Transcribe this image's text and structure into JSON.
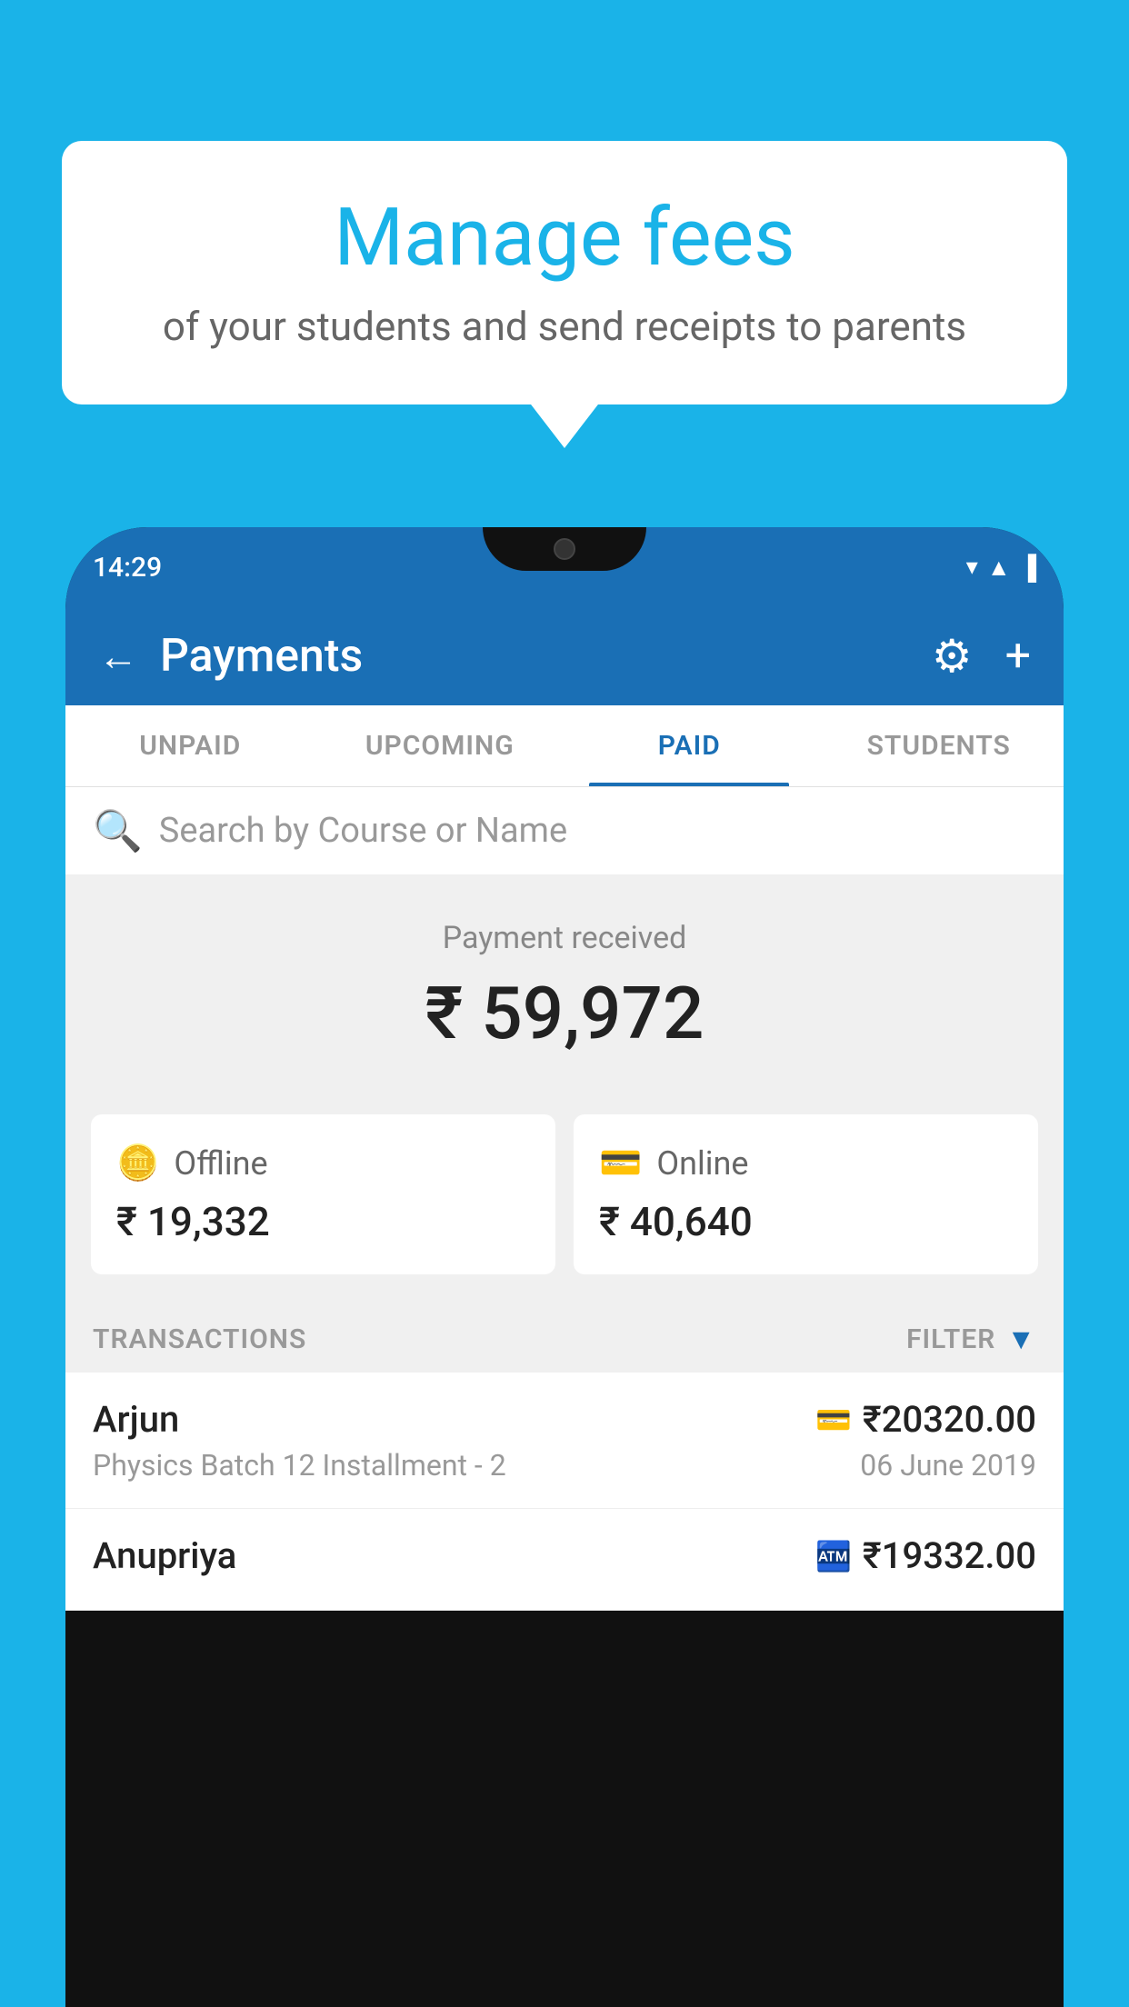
{
  "background_color": "#1ab3e8",
  "bubble": {
    "title": "Manage fees",
    "subtitle": "of your students and send receipts to parents"
  },
  "phone": {
    "status_bar": {
      "time": "14:29",
      "icons": [
        "▲",
        "◀",
        "▌"
      ]
    },
    "header": {
      "title": "Payments",
      "back_label": "←",
      "gear_label": "⚙",
      "plus_label": "+"
    },
    "tabs": [
      {
        "label": "UNPAID",
        "active": false
      },
      {
        "label": "UPCOMING",
        "active": false
      },
      {
        "label": "PAID",
        "active": true
      },
      {
        "label": "STUDENTS",
        "active": false
      }
    ],
    "search": {
      "placeholder": "Search by Course or Name"
    },
    "payment_summary": {
      "label": "Payment received",
      "amount": "₹ 59,972",
      "offline": {
        "type": "Offline",
        "amount": "₹ 19,332"
      },
      "online": {
        "type": "Online",
        "amount": "₹ 40,640"
      }
    },
    "transactions": {
      "label": "TRANSACTIONS",
      "filter_label": "FILTER",
      "rows": [
        {
          "name": "Arjun",
          "course": "Physics Batch 12 Installment - 2",
          "amount": "₹20320.00",
          "date": "06 June 2019",
          "payment_type": "card"
        },
        {
          "name": "Anupriya",
          "course": "",
          "amount": "₹19332.00",
          "date": "",
          "payment_type": "wallet"
        }
      ]
    }
  }
}
